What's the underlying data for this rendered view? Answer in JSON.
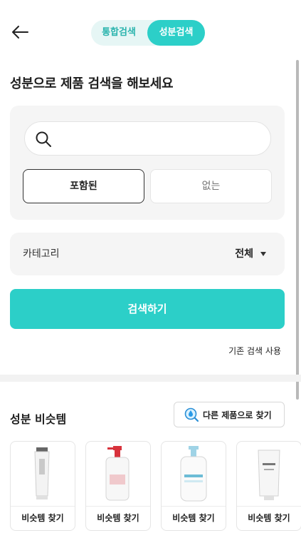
{
  "header": {
    "back_icon": "arrow-left-icon",
    "tabs": [
      {
        "label": "통합검색",
        "active": false
      },
      {
        "label": "성분검색",
        "active": true
      }
    ]
  },
  "main": {
    "title": "성분으로 제품 검색을 해보세요",
    "search": {
      "placeholder": "",
      "value": "",
      "icon": "search-icon"
    },
    "filters": [
      {
        "label": "포함된",
        "selected": true
      },
      {
        "label": "없는",
        "selected": false
      }
    ],
    "category": {
      "label": "카테고리",
      "value": "전체",
      "icon": "caret-down-icon"
    },
    "search_button": "검색하기",
    "legacy_search": "기존 검색 사용"
  },
  "lookalike": {
    "title": "성분 비슷템",
    "other_button": "다른 제품으로 찾기",
    "other_icon": "drop-search-icon",
    "items": [
      {
        "button": "비슷템 찾기"
      },
      {
        "button": "비슷템 찾기"
      },
      {
        "button": "비슷템 찾기"
      },
      {
        "button": "비슷템 찾기"
      }
    ]
  },
  "colors": {
    "accent": "#2ccfc8",
    "tab_bg": "#e6f6f5",
    "panel_bg": "#f5f5f5"
  }
}
